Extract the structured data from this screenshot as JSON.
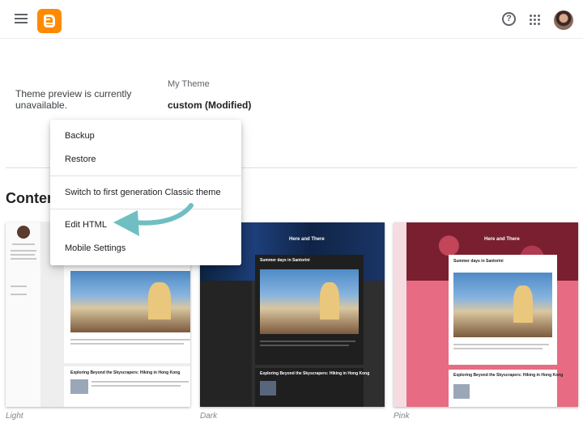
{
  "header": {
    "menu_icon": "hamburger-menu-icon",
    "logo_icon": "blogger-logo-icon",
    "help_icon": "help-circle-icon",
    "apps_icon": "apps-grid-icon",
    "avatar": "user-avatar"
  },
  "theme": {
    "preview_message": "Theme preview is currently unavailable.",
    "my_theme_label": "My Theme",
    "theme_name": "custom (Modified)"
  },
  "menu": {
    "items": [
      "Backup",
      "Restore",
      "Switch to first generation Classic theme",
      "Edit HTML",
      "Mobile Settings"
    ],
    "highlight_arrow_color": "#6fbfc2"
  },
  "section": {
    "title": "Conten"
  },
  "themes": [
    {
      "caption": "Light",
      "post_title": "Exploring Beyond the Skyscrapers: Hiking in Hong Kong"
    },
    {
      "caption": "Dark",
      "blog_title": "Here and There",
      "post_title": "Summer days in Santorini",
      "post_title_2": "Exploring Beyond the Skyscrapers: Hiking in Hong Kong"
    },
    {
      "caption": "Pink",
      "blog_title": "Here and There",
      "post_title": "Summer days in Santorini",
      "post_title_2": "Exploring Beyond the Skyscrapers: Hiking in Hong Kong"
    }
  ],
  "colors": {
    "brand_orange": "#ff8a00",
    "accent_red": "#e04e39"
  }
}
